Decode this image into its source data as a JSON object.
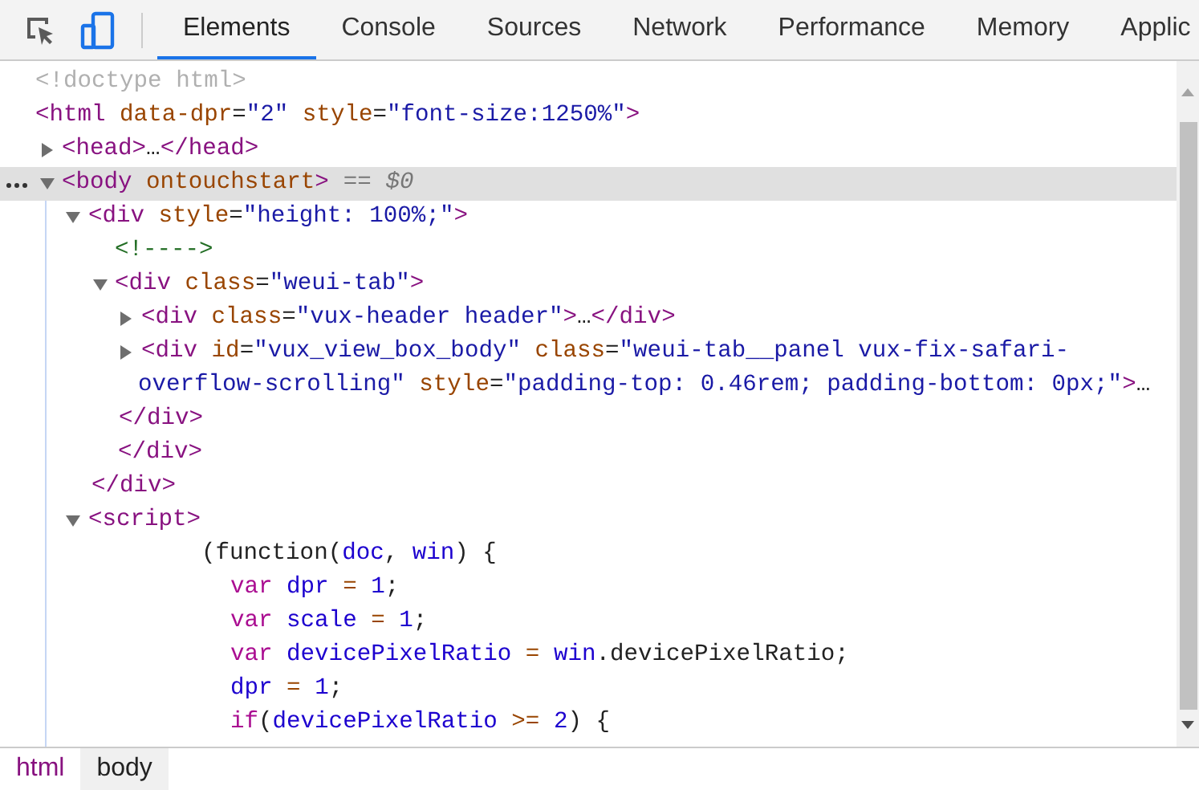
{
  "tabs": [
    {
      "label": "Elements",
      "selected": true
    },
    {
      "label": "Console",
      "selected": false
    },
    {
      "label": "Sources",
      "selected": false
    },
    {
      "label": "Network",
      "selected": false
    },
    {
      "label": "Performance",
      "selected": false
    },
    {
      "label": "Memory",
      "selected": false
    },
    {
      "label": "Applic",
      "selected": false
    }
  ],
  "tree": [
    {
      "kind": "markup",
      "selected": false,
      "parts": [
        {
          "kind": "doctype",
          "text": "<!doctype html>"
        }
      ]
    },
    {
      "kind": "markup",
      "selected": false,
      "parts": [
        {
          "kind": "tag",
          "text": "<html"
        },
        {
          "kind": "attr",
          "text": " data-dpr"
        },
        {
          "kind": "punct",
          "text": "="
        },
        {
          "kind": "value",
          "text": "\"2\""
        },
        {
          "kind": "attr",
          "text": " style"
        },
        {
          "kind": "punct",
          "text": "="
        },
        {
          "kind": "value",
          "text": "\"font-size:1250%\""
        },
        {
          "kind": "tag",
          "text": ">"
        }
      ],
      "children": [
        {
          "kind": "markup",
          "selected": false,
          "expanded": false,
          "parts": [
            {
              "kind": "tag",
              "text": "<head>"
            },
            {
              "kind": "punct",
              "text": "…"
            },
            {
              "kind": "tag",
              "text": "</head>"
            }
          ]
        },
        {
          "kind": "markup",
          "selected": true,
          "expanded": true,
          "note": "== $0",
          "parts": [
            {
              "kind": "tag",
              "text": "<body"
            },
            {
              "kind": "attr",
              "text": " ontouchstart"
            },
            {
              "kind": "tag",
              "text": ">"
            }
          ],
          "children": [
            {
              "kind": "markup",
              "selected": false,
              "expanded": true,
              "parts": [
                {
                  "kind": "tag",
                  "text": "<div"
                },
                {
                  "kind": "attr",
                  "text": " style"
                },
                {
                  "kind": "punct",
                  "text": "="
                },
                {
                  "kind": "value",
                  "text": "\"height: 100%;\""
                },
                {
                  "kind": "tag",
                  "text": ">"
                }
              ],
              "closing": "</div>",
              "children": [
                {
                  "kind": "markup",
                  "selected": false,
                  "parts": [
                    {
                      "kind": "comment",
                      "text": "<!---->"
                    }
                  ]
                },
                {
                  "kind": "markup",
                  "selected": false,
                  "expanded": true,
                  "parts": [
                    {
                      "kind": "tag",
                      "text": "<div"
                    },
                    {
                      "kind": "attr",
                      "text": " class"
                    },
                    {
                      "kind": "punct",
                      "text": "="
                    },
                    {
                      "kind": "value",
                      "text": "\"weui-tab\""
                    },
                    {
                      "kind": "tag",
                      "text": ">"
                    }
                  ],
                  "closing": "</div>",
                  "children": [
                    {
                      "kind": "markup",
                      "selected": false,
                      "expanded": false,
                      "parts": [
                        {
                          "kind": "tag",
                          "text": "<div"
                        },
                        {
                          "kind": "attr",
                          "text": " class"
                        },
                        {
                          "kind": "punct",
                          "text": "="
                        },
                        {
                          "kind": "value",
                          "text": "\"vux-header header\""
                        },
                        {
                          "kind": "tag",
                          "text": ">"
                        },
                        {
                          "kind": "punct",
                          "text": "…"
                        },
                        {
                          "kind": "tag",
                          "text": "</div>"
                        }
                      ]
                    },
                    {
                      "kind": "markup",
                      "selected": false,
                      "expanded": false,
                      "parts": [
                        {
                          "kind": "tag",
                          "text": "<div"
                        },
                        {
                          "kind": "attr",
                          "text": " id"
                        },
                        {
                          "kind": "punct",
                          "text": "="
                        },
                        {
                          "kind": "value",
                          "text": "\"vux_view_box_body\""
                        },
                        {
                          "kind": "attr",
                          "text": " class"
                        },
                        {
                          "kind": "punct",
                          "text": "="
                        },
                        {
                          "kind": "value",
                          "text": "\"weui-tab__panel vux-fix-safari-overflow-scrolling\""
                        },
                        {
                          "kind": "attr",
                          "text": " style"
                        },
                        {
                          "kind": "punct",
                          "text": "="
                        },
                        {
                          "kind": "value",
                          "text": "\"padding-top: 0.46rem; padding-bottom: 0px;\""
                        },
                        {
                          "kind": "tag",
                          "text": ">"
                        },
                        {
                          "kind": "punct",
                          "text": "…"
                        }
                      ],
                      "closing": "</div>"
                    }
                  ]
                }
              ]
            },
            {
              "kind": "markup",
              "selected": false,
              "expanded": true,
              "parts": [
                {
                  "kind": "tag",
                  "text": "<script>"
                }
              ],
              "children": [
                {
                  "kind": "script-text",
                  "lines": [
                    {
                      "parts": [
                        {
                          "kind": "plain",
                          "text": "("
                        },
                        {
                          "kind": "js-word",
                          "text": "function"
                        },
                        {
                          "kind": "plain",
                          "text": "("
                        },
                        {
                          "kind": "js-name",
                          "text": "doc"
                        },
                        {
                          "kind": "plain",
                          "text": ", "
                        },
                        {
                          "kind": "js-name",
                          "text": "win"
                        },
                        {
                          "kind": "plain",
                          "text": ") {"
                        }
                      ],
                      "children": [
                        {
                          "parts": [
                            {
                              "kind": "js-kw",
                              "text": "var"
                            },
                            {
                              "kind": "js-name",
                              "text": " dpr"
                            },
                            {
                              "kind": "js-op",
                              "text": " = "
                            },
                            {
                              "kind": "js-num",
                              "text": "1"
                            },
                            {
                              "kind": "plain",
                              "text": ";"
                            }
                          ]
                        },
                        {
                          "parts": [
                            {
                              "kind": "js-kw",
                              "text": "var"
                            },
                            {
                              "kind": "js-name",
                              "text": " scale"
                            },
                            {
                              "kind": "js-op",
                              "text": " = "
                            },
                            {
                              "kind": "js-num",
                              "text": "1"
                            },
                            {
                              "kind": "plain",
                              "text": ";"
                            }
                          ]
                        },
                        {
                          "parts": [
                            {
                              "kind": "js-kw",
                              "text": "var"
                            },
                            {
                              "kind": "js-name",
                              "text": " devicePixelRatio"
                            },
                            {
                              "kind": "js-op",
                              "text": " = "
                            },
                            {
                              "kind": "js-name",
                              "text": "win"
                            },
                            {
                              "kind": "plain",
                              "text": ".devicePixelRatio;"
                            }
                          ]
                        },
                        {
                          "parts": [
                            {
                              "kind": "js-name",
                              "text": "dpr"
                            },
                            {
                              "kind": "js-op",
                              "text": " = "
                            },
                            {
                              "kind": "js-num",
                              "text": "1"
                            },
                            {
                              "kind": "plain",
                              "text": ";"
                            }
                          ]
                        },
                        {
                          "parts": [
                            {
                              "kind": "js-kw",
                              "text": "if"
                            },
                            {
                              "kind": "plain",
                              "text": "("
                            },
                            {
                              "kind": "js-name",
                              "text": "devicePixelRatio"
                            },
                            {
                              "kind": "js-op",
                              "text": " >= "
                            },
                            {
                              "kind": "js-num",
                              "text": "2"
                            },
                            {
                              "kind": "plain",
                              "text": ") {"
                            }
                          ]
                        }
                      ]
                    }
                  ]
                }
              ]
            }
          ]
        }
      ]
    }
  ],
  "breadcrumbs": [
    {
      "label": "html",
      "selected": false
    },
    {
      "label": "body",
      "selected": true
    }
  ]
}
